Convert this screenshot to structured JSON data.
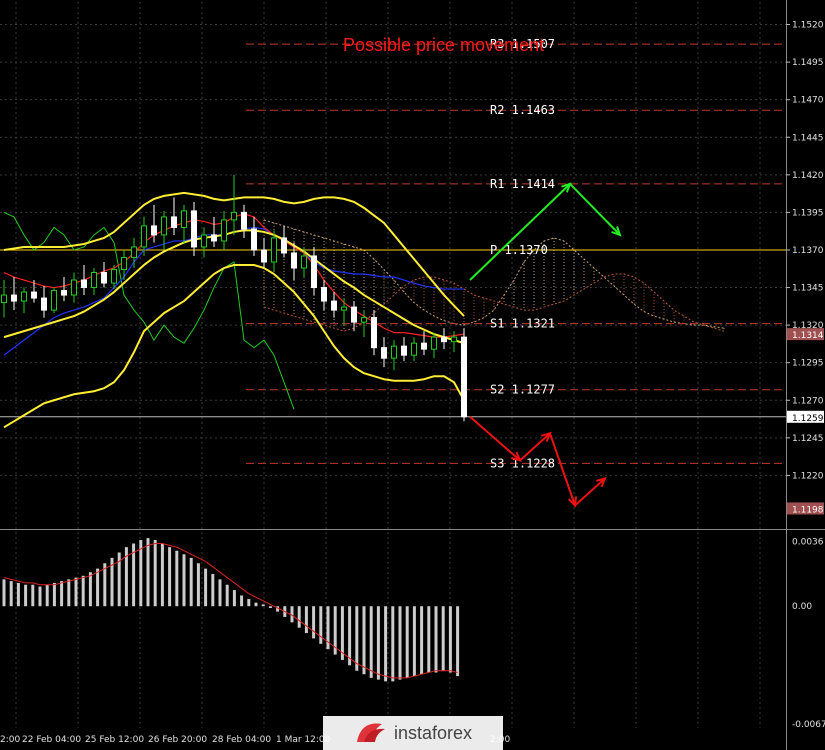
{
  "colors": {
    "background": "#000000",
    "grid": "#3a3a3a",
    "axis_text": "#e0e0e0",
    "title": "#ff1a1a",
    "pivot_line": "#ffcc00",
    "level_line": "#c0392b",
    "bollinger": "#ffee33",
    "tenkan": "#ff2222",
    "kijun": "#2233ff",
    "chikou": "#22cc22",
    "bull_candle": "#22cc22",
    "bear_candle": "#ffffff",
    "up_arrow": "#22ee22",
    "down_arrow": "#ee1111",
    "histogram": "#cccccc",
    "signal": "#dd2222"
  },
  "chart_data": {
    "type": "candlestick",
    "title": "Possible price movement",
    "price_axis": {
      "ticks": [
        "1.1520",
        "1.1495",
        "1.1470",
        "1.1445",
        "1.1420",
        "1.1395",
        "1.1370",
        "1.1345",
        "1.1320",
        "1.1295",
        "1.1270",
        "1.1245",
        "1.1220"
      ],
      "ylim": [
        1.1185,
        1.1535
      ],
      "current_price": "1.1259",
      "marker_1314": "1.1314",
      "marker_1198": "1.1198"
    },
    "time_axis": {
      "labels": [
        "2:00",
        "22 Feb 04:00",
        "25 Feb 12:00",
        "26 Feb 20:00",
        "28 Feb 04:00",
        "1 Mar 12:00",
        "2:00"
      ]
    },
    "levels": [
      {
        "name": "R3",
        "value": 1.1507,
        "label": "R3  1.1507"
      },
      {
        "name": "R2",
        "value": 1.1463,
        "label": "R2  1.1463"
      },
      {
        "name": "R1",
        "value": 1.1414,
        "label": "R1  1.1414"
      },
      {
        "name": "P",
        "value": 1.137,
        "label": "P  1.1370"
      },
      {
        "name": "S1",
        "value": 1.1321,
        "label": "S1  1.1321"
      },
      {
        "name": "S2",
        "value": 1.1277,
        "label": "S2  1.1277"
      },
      {
        "name": "S3",
        "value": 1.1228,
        "label": "S3  1.1228"
      }
    ],
    "candles": [
      {
        "o": 1.1335,
        "h": 1.135,
        "l": 1.1325,
        "c": 1.134
      },
      {
        "o": 1.134,
        "h": 1.1352,
        "l": 1.133,
        "c": 1.1336
      },
      {
        "o": 1.1336,
        "h": 1.1345,
        "l": 1.1328,
        "c": 1.1342
      },
      {
        "o": 1.1342,
        "h": 1.135,
        "l": 1.1335,
        "c": 1.1338
      },
      {
        "o": 1.1338,
        "h": 1.1346,
        "l": 1.1325,
        "c": 1.133
      },
      {
        "o": 1.133,
        "h": 1.1345,
        "l": 1.1328,
        "c": 1.1343
      },
      {
        "o": 1.1343,
        "h": 1.1352,
        "l": 1.1336,
        "c": 1.134
      },
      {
        "o": 1.134,
        "h": 1.1355,
        "l": 1.1335,
        "c": 1.135
      },
      {
        "o": 1.135,
        "h": 1.136,
        "l": 1.134,
        "c": 1.1345
      },
      {
        "o": 1.1345,
        "h": 1.1358,
        "l": 1.134,
        "c": 1.1355
      },
      {
        "o": 1.1355,
        "h": 1.1362,
        "l": 1.1345,
        "c": 1.1348
      },
      {
        "o": 1.1348,
        "h": 1.136,
        "l": 1.1344,
        "c": 1.1357
      },
      {
        "o": 1.1357,
        "h": 1.137,
        "l": 1.135,
        "c": 1.1365
      },
      {
        "o": 1.1365,
        "h": 1.1378,
        "l": 1.1358,
        "c": 1.1372
      },
      {
        "o": 1.1372,
        "h": 1.1392,
        "l": 1.1366,
        "c": 1.1386
      },
      {
        "o": 1.1386,
        "h": 1.14,
        "l": 1.1375,
        "c": 1.138
      },
      {
        "o": 1.138,
        "h": 1.1396,
        "l": 1.137,
        "c": 1.1392
      },
      {
        "o": 1.1392,
        "h": 1.1405,
        "l": 1.138,
        "c": 1.1385
      },
      {
        "o": 1.1385,
        "h": 1.14,
        "l": 1.1374,
        "c": 1.1396
      },
      {
        "o": 1.1396,
        "h": 1.1402,
        "l": 1.1366,
        "c": 1.1372
      },
      {
        "o": 1.1372,
        "h": 1.1385,
        "l": 1.1365,
        "c": 1.138
      },
      {
        "o": 1.138,
        "h": 1.1392,
        "l": 1.1372,
        "c": 1.1376
      },
      {
        "o": 1.1376,
        "h": 1.1396,
        "l": 1.137,
        "c": 1.139
      },
      {
        "o": 1.139,
        "h": 1.142,
        "l": 1.138,
        "c": 1.1395
      },
      {
        "o": 1.1395,
        "h": 1.14,
        "l": 1.1378,
        "c": 1.1384
      },
      {
        "o": 1.1384,
        "h": 1.1392,
        "l": 1.1366,
        "c": 1.137
      },
      {
        "o": 1.137,
        "h": 1.1378,
        "l": 1.1358,
        "c": 1.1362
      },
      {
        "o": 1.1362,
        "h": 1.1383,
        "l": 1.1356,
        "c": 1.1378
      },
      {
        "o": 1.1378,
        "h": 1.1386,
        "l": 1.1365,
        "c": 1.1368
      },
      {
        "o": 1.1368,
        "h": 1.1375,
        "l": 1.135,
        "c": 1.1358
      },
      {
        "o": 1.1358,
        "h": 1.1372,
        "l": 1.1352,
        "c": 1.1366
      },
      {
        "o": 1.1366,
        "h": 1.1372,
        "l": 1.134,
        "c": 1.1345
      },
      {
        "o": 1.1345,
        "h": 1.135,
        "l": 1.133,
        "c": 1.1336
      },
      {
        "o": 1.1336,
        "h": 1.1342,
        "l": 1.1325,
        "c": 1.133
      },
      {
        "o": 1.133,
        "h": 1.1338,
        "l": 1.132,
        "c": 1.1332
      },
      {
        "o": 1.1332,
        "h": 1.1336,
        "l": 1.1316,
        "c": 1.1322
      },
      {
        "o": 1.1322,
        "h": 1.133,
        "l": 1.1312,
        "c": 1.1325
      },
      {
        "o": 1.1325,
        "h": 1.133,
        "l": 1.13,
        "c": 1.1305
      },
      {
        "o": 1.1305,
        "h": 1.1312,
        "l": 1.1292,
        "c": 1.1298
      },
      {
        "o": 1.1298,
        "h": 1.131,
        "l": 1.129,
        "c": 1.1306
      },
      {
        "o": 1.1306,
        "h": 1.1312,
        "l": 1.1296,
        "c": 1.13
      },
      {
        "o": 1.13,
        "h": 1.1312,
        "l": 1.1296,
        "c": 1.1308
      },
      {
        "o": 1.1308,
        "h": 1.1316,
        "l": 1.13,
        "c": 1.1304
      },
      {
        "o": 1.1304,
        "h": 1.1315,
        "l": 1.1298,
        "c": 1.1312
      },
      {
        "o": 1.1312,
        "h": 1.1318,
        "l": 1.1304,
        "c": 1.1309
      },
      {
        "o": 1.1309,
        "h": 1.1316,
        "l": 1.1302,
        "c": 1.1312
      },
      {
        "o": 1.1312,
        "h": 1.1318,
        "l": 1.1256,
        "c": 1.1259
      }
    ],
    "indicators": {
      "tenkan": [
        1.1355,
        1.1352,
        1.135,
        1.1348,
        1.1346,
        1.1345,
        1.1346,
        1.1348,
        1.135,
        1.1353,
        1.1356,
        1.1358,
        1.1362,
        1.1368,
        1.1375,
        1.138,
        1.1383,
        1.1386,
        1.1388,
        1.139,
        1.1389,
        1.1387,
        1.1388,
        1.1392,
        1.1394,
        1.1392,
        1.1385,
        1.138,
        1.1376,
        1.1372,
        1.1368,
        1.136,
        1.135,
        1.1342,
        1.1335,
        1.133,
        1.1326,
        1.1322,
        1.1318,
        1.1315,
        1.1315,
        1.1314,
        1.1313,
        1.1312,
        1.1312,
        1.1313,
        1.1314
      ],
      "kijun": [
        1.13,
        1.1305,
        1.131,
        1.1315,
        1.132,
        1.1325,
        1.1328,
        1.133,
        1.1332,
        1.1335,
        1.1338,
        1.1345,
        1.1352,
        1.1362,
        1.137,
        1.1372,
        1.1374,
        1.1376,
        1.1376,
        1.1378,
        1.138,
        1.138,
        1.138,
        1.1382,
        1.1384,
        1.1385,
        1.1384,
        1.138,
        1.1376,
        1.1372,
        1.1368,
        1.1362,
        1.1358,
        1.1356,
        1.1355,
        1.1354,
        1.1354,
        1.1353,
        1.1352,
        1.1352,
        1.135,
        1.1348,
        1.1346,
        1.1345,
        1.1344,
        1.1344,
        1.1344
      ],
      "bb_upper": [
        1.137,
        1.1371,
        1.1372,
        1.1372,
        1.1372,
        1.1372,
        1.1372,
        1.1373,
        1.1374,
        1.1376,
        1.1378,
        1.1382,
        1.1388,
        1.1394,
        1.14,
        1.1404,
        1.1406,
        1.1407,
        1.1408,
        1.1407,
        1.1406,
        1.1404,
        1.1403,
        1.1404,
        1.1405,
        1.1405,
        1.1405,
        1.1404,
        1.1402,
        1.1401,
        1.1402,
        1.1404,
        1.1405,
        1.1405,
        1.1404,
        1.1402,
        1.1398,
        1.1393,
        1.1388,
        1.138,
        1.1372,
        1.1364,
        1.1356,
        1.1348,
        1.134,
        1.1333,
        1.1326
      ],
      "bb_mid": [
        1.1312,
        1.1314,
        1.1316,
        1.1318,
        1.132,
        1.1322,
        1.1324,
        1.1326,
        1.1329,
        1.1333,
        1.1337,
        1.1342,
        1.1348,
        1.1354,
        1.136,
        1.1365,
        1.1369,
        1.1372,
        1.1375,
        1.1377,
        1.1378,
        1.1379,
        1.138,
        1.1382,
        1.1383,
        1.1383,
        1.1382,
        1.138,
        1.1377,
        1.1373,
        1.1369,
        1.1364,
        1.1359,
        1.1354,
        1.1349,
        1.1345,
        1.134,
        1.1336,
        1.1332,
        1.1328,
        1.1324,
        1.132,
        1.1317,
        1.1314,
        1.1312,
        1.131,
        1.1308
      ],
      "bb_lower": [
        1.1252,
        1.1256,
        1.126,
        1.1264,
        1.1268,
        1.127,
        1.1272,
        1.1274,
        1.1275,
        1.1276,
        1.1278,
        1.1282,
        1.129,
        1.1302,
        1.1316,
        1.1322,
        1.1328,
        1.1332,
        1.1336,
        1.1342,
        1.1348,
        1.1354,
        1.1358,
        1.136,
        1.136,
        1.136,
        1.1358,
        1.1354,
        1.1348,
        1.1342,
        1.1334,
        1.1326,
        1.1316,
        1.1306,
        1.1298,
        1.1292,
        1.1288,
        1.1286,
        1.1284,
        1.1283,
        1.1283,
        1.1283,
        1.1284,
        1.1286,
        1.1286,
        1.1282,
        1.127
      ],
      "chikou": [
        1.1395,
        1.1392,
        1.138,
        1.137,
        1.1375,
        1.1385,
        1.138,
        1.137,
        1.1372,
        1.138,
        1.1385,
        1.1375,
        1.134,
        1.133,
        1.1322,
        1.131,
        1.132,
        1.1312,
        1.1308,
        1.1318,
        1.133,
        1.1345,
        1.1358,
        1.1362,
        1.131,
        1.1305,
        1.131,
        1.13,
        1.1282,
        1.1264
      ]
    },
    "cloud": {
      "start": 26,
      "a": [
        1.139,
        1.1388,
        1.1386,
        1.1384,
        1.1382,
        1.138,
        1.1378,
        1.1376,
        1.1374,
        1.1372,
        1.137,
        1.1364,
        1.1357,
        1.135,
        1.1342,
        1.1335,
        1.133,
        1.1326,
        1.1323,
        1.1321,
        1.132,
        1.1322,
        1.1325,
        1.133,
        1.134,
        1.135,
        1.1362,
        1.137,
        1.1376,
        1.1378,
        1.1376,
        1.137,
        1.1364,
        1.1358,
        1.1352,
        1.1346,
        1.134,
        1.1334,
        1.1329,
        1.1326,
        1.1324,
        1.1322,
        1.1321,
        1.132,
        1.132,
        1.1319,
        1.1318
      ],
      "b": [
        1.1332,
        1.133,
        1.1328,
        1.1326,
        1.1324,
        1.1322,
        1.132,
        1.1318,
        1.1316,
        1.1318,
        1.1322,
        1.1328,
        1.1334,
        1.134,
        1.1346,
        1.135,
        1.1352,
        1.1352,
        1.135,
        1.1348,
        1.1344,
        1.134,
        1.1338,
        1.1336,
        1.1334,
        1.1332,
        1.133,
        1.133,
        1.1332,
        1.1334,
        1.1336,
        1.134,
        1.1344,
        1.1348,
        1.1352,
        1.1354,
        1.1354,
        1.1352,
        1.1348,
        1.1342,
        1.1336,
        1.133,
        1.1326,
        1.1322,
        1.132,
        1.1318,
        1.1316
      ]
    },
    "forecast_up": [
      [
        1.135,
        0
      ],
      [
        1.1414,
        20
      ],
      [
        1.138,
        30
      ]
    ],
    "forecast_down": [
      [
        1.1259,
        0
      ],
      [
        1.123,
        10
      ],
      [
        1.1248,
        16
      ],
      [
        1.12,
        21
      ],
      [
        1.1218,
        27
      ]
    ],
    "macd": {
      "labels": [
        "0.0036",
        "0.00",
        "-0.00677"
      ],
      "ylim": [
        -0.0068,
        0.0042
      ],
      "histogram": [
        0.0015,
        0.0014,
        0.0013,
        0.0012,
        0.0012,
        0.0011,
        0.0012,
        0.0013,
        0.0014,
        0.0015,
        0.0016,
        0.0017,
        0.0019,
        0.0021,
        0.0024,
        0.0027,
        0.003,
        0.0033,
        0.0035,
        0.0037,
        0.0038,
        0.0037,
        0.0035,
        0.0033,
        0.0031,
        0.0029,
        0.0027,
        0.0024,
        0.0021,
        0.0018,
        0.0015,
        0.0012,
        0.0009,
        0.0006,
        0.0004,
        0.0002,
        0.0001,
        -0.0001,
        -0.0003,
        -0.0006,
        -0.0009,
        -0.0012,
        -0.0015,
        -0.0018,
        -0.0021,
        -0.0024,
        -0.0027,
        -0.003,
        -0.0033,
        -0.0036,
        -0.0038,
        -0.004,
        -0.0041,
        -0.0042,
        -0.0042,
        -0.0041,
        -0.004,
        -0.0039,
        -0.0038,
        -0.0037,
        -0.0037,
        -0.0036,
        -0.0037,
        -0.0039
      ],
      "signal": [
        0.0016,
        0.0015,
        0.0014,
        0.0013,
        0.0013,
        0.0012,
        0.0012,
        0.0012,
        0.0013,
        0.0014,
        0.0015,
        0.0016,
        0.0017,
        0.0019,
        0.0021,
        0.0023,
        0.0025,
        0.0028,
        0.003,
        0.0032,
        0.0034,
        0.0035,
        0.0035,
        0.0034,
        0.0033,
        0.0031,
        0.0029,
        0.0027,
        0.0025,
        0.0022,
        0.0019,
        0.0016,
        0.0013,
        0.001,
        0.0007,
        0.0005,
        0.0003,
        0.0001,
        -0.0001,
        -0.0003,
        -0.0005,
        -0.0008,
        -0.0011,
        -0.0014,
        -0.0017,
        -0.002,
        -0.0023,
        -0.0026,
        -0.0029,
        -0.0032,
        -0.0034,
        -0.0036,
        -0.0038,
        -0.0039,
        -0.004,
        -0.004,
        -0.004,
        -0.0039,
        -0.0038,
        -0.0037,
        -0.0036,
        -0.0036,
        -0.0036,
        -0.0037
      ]
    }
  },
  "watermark": {
    "text": "instaforex",
    "icon": "instaforex-logo-icon"
  }
}
